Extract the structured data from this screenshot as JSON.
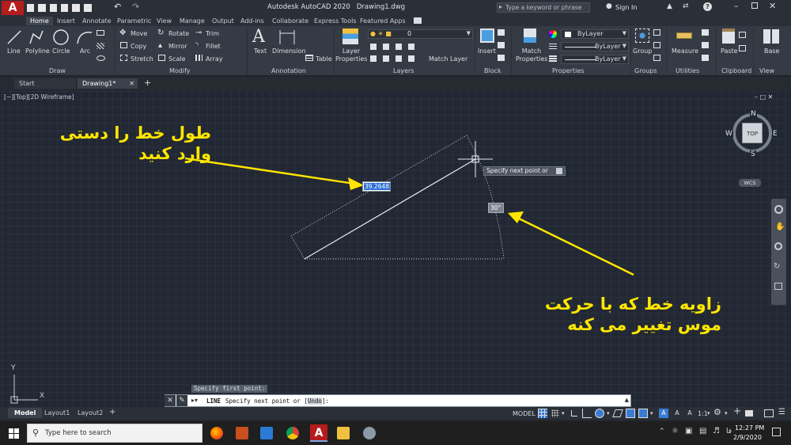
{
  "title_bar": {
    "title": "Autodesk AutoCAD 2020   Drawing1.dwg",
    "search_placeholder": "Type a keyword or phrase",
    "sign_in": "Sign In"
  },
  "ribbon_tabs": [
    "Home",
    "Insert",
    "Annotate",
    "Parametric",
    "View",
    "Manage",
    "Output",
    "Add-ins",
    "Collaborate",
    "Express Tools",
    "Featured Apps"
  ],
  "ribbon": {
    "draw": {
      "line": "Line",
      "polyline": "Polyline",
      "circle": "Circle",
      "arc": "Arc",
      "group": "Draw"
    },
    "modify": {
      "move": "Move",
      "rotate": "Rotate",
      "trim": "Trim",
      "copy": "Copy",
      "mirror": "Mirror",
      "fillet": "Fillet",
      "stretch": "Stretch",
      "scale": "Scale",
      "array": "Array",
      "group": "Modify"
    },
    "annotation": {
      "text": "Text",
      "dimension": "Dimension",
      "table": "Table",
      "group": "Annotation"
    },
    "layers": {
      "layer_value": "0",
      "layer_properties": "Layer Properties",
      "match_layer": "Match Layer",
      "group": "Layers"
    },
    "block": {
      "insert": "Insert",
      "group": "Block"
    },
    "properties": {
      "match_properties": "Match Properties",
      "color": "ByLayer",
      "linetype": "ByLayer",
      "lineweight": "ByLayer",
      "group": "Properties"
    },
    "groups": {
      "group_btn": "Group",
      "group": "Groups"
    },
    "utilities": {
      "measure": "Measure",
      "group": "Utilities"
    },
    "clipboard": {
      "paste": "Paste",
      "group": "Clipboard"
    },
    "view": {
      "base": "Base",
      "group": "View"
    }
  },
  "file_tabs": {
    "start": "Start",
    "drawing": "Drawing1*"
  },
  "viewport": {
    "label": "[−][Top][2D Wireframe]",
    "tooltip": "Specify next point or",
    "length_value": "39.2648",
    "angle_value": "30°",
    "viewcube": {
      "n": "N",
      "s": "S",
      "e": "E",
      "w": "W",
      "top": "TOP",
      "wcs": "WCS"
    },
    "ucs_x": "X",
    "ucs_y": "Y"
  },
  "annotations": {
    "top_left": "طول خط را دستی وارد کنید",
    "bottom_right": "زاویه خط که با حرکت موس تغییر می کنه",
    "color": "#ffe600"
  },
  "command": {
    "history": "Specify first point:",
    "prompt_cmd": "LINE",
    "prompt": "Specify next point or [",
    "option": "Undo",
    "prompt_end": "]:"
  },
  "layout_tabs": [
    "Model",
    "Layout1",
    "Layout2"
  ],
  "status": {
    "model": "MODEL",
    "scale": "1:1"
  },
  "taskbar": {
    "search_placeholder": "Type here to search",
    "time": "12:27 PM",
    "date": "2/9/2020",
    "lang": "فا"
  }
}
